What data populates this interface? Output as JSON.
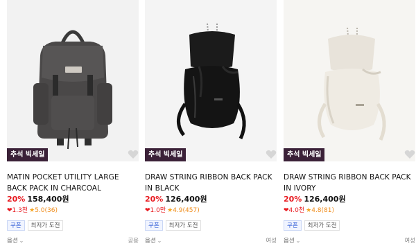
{
  "products": [
    {
      "badge": "추석 빅세일",
      "title": "MATIN POCKET UTILITY LARGE BACK PACK IN CHARCOAL",
      "discount": "20%",
      "price": "158,400원",
      "likes": "1.3천",
      "rating": "5.0(36)",
      "chips": [
        "쿠폰",
        "최저가 도전"
      ],
      "option_label": "옵션",
      "gender": "공용",
      "image_icon": "charcoal-backpack-photo"
    },
    {
      "badge": "추석 빅세일",
      "title": "DRAW STRING RIBBON BACK PACK IN BLACK",
      "discount": "20%",
      "price": "126,400원",
      "likes": "1.0만",
      "rating": "4.9(457)",
      "chips": [
        "쿠폰",
        "최저가 도전"
      ],
      "option_label": "옵션",
      "gender": "여성",
      "image_icon": "black-bucket-backpack-photo"
    },
    {
      "badge": "추석 빅세일",
      "title": "DRAW STRING RIBBON BACK PACK IN IVORY",
      "discount": "20%",
      "price": "126,400원",
      "likes": "4.0천",
      "rating": "4.8(81)",
      "chips": [
        "쿠폰",
        "최저가 도전"
      ],
      "option_label": "옵션",
      "gender": "여성",
      "image_icon": "ivory-bucket-backpack-photo"
    }
  ],
  "colors": {
    "discount": "#e8191f",
    "badge_bg": "#3b2138",
    "star": "#f5a623",
    "coupon": "#3a64d8"
  }
}
